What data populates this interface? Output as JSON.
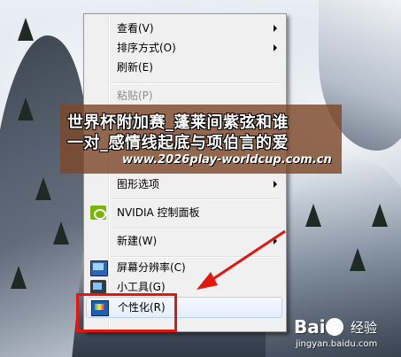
{
  "menu": {
    "items": [
      {
        "label": "查看(V)",
        "submenu": true,
        "enabled": true
      },
      {
        "label": "排序方式(O)",
        "submenu": true,
        "enabled": true
      },
      {
        "label": "刷新(E)",
        "submenu": false,
        "enabled": true
      },
      {
        "label": "粘贴(P)",
        "submenu": false,
        "enabled": false
      },
      {
        "label": "图形选项",
        "submenu": true,
        "enabled": true
      },
      {
        "label": "NVIDIA 控制面板",
        "submenu": false,
        "enabled": true,
        "icon": "nvidia-icon"
      },
      {
        "label": "新建(W)",
        "submenu": true,
        "enabled": true
      },
      {
        "label": "屏幕分辨率(C)",
        "submenu": false,
        "enabled": true,
        "icon": "monitor-icon"
      },
      {
        "label": "小工具(G)",
        "submenu": false,
        "enabled": true,
        "icon": "gadget-icon"
      },
      {
        "label": "个性化(R)",
        "submenu": false,
        "enabled": true,
        "icon": "personalize-icon",
        "highlighted": true
      }
    ]
  },
  "watermark": {
    "line1": "世界杯附加赛_蓬莱间紫弦和谁",
    "line2": "一对_感情线起底与项伯言的爱",
    "url": "www.2026play-worldcup.com.cn"
  },
  "logo": {
    "brand": "Bai",
    "suffix": "经验",
    "url": "jingyan.baidu.com"
  },
  "colors": {
    "annotation": "#e3170d",
    "banner": "#7d4828",
    "nvidia": "#76b900"
  }
}
